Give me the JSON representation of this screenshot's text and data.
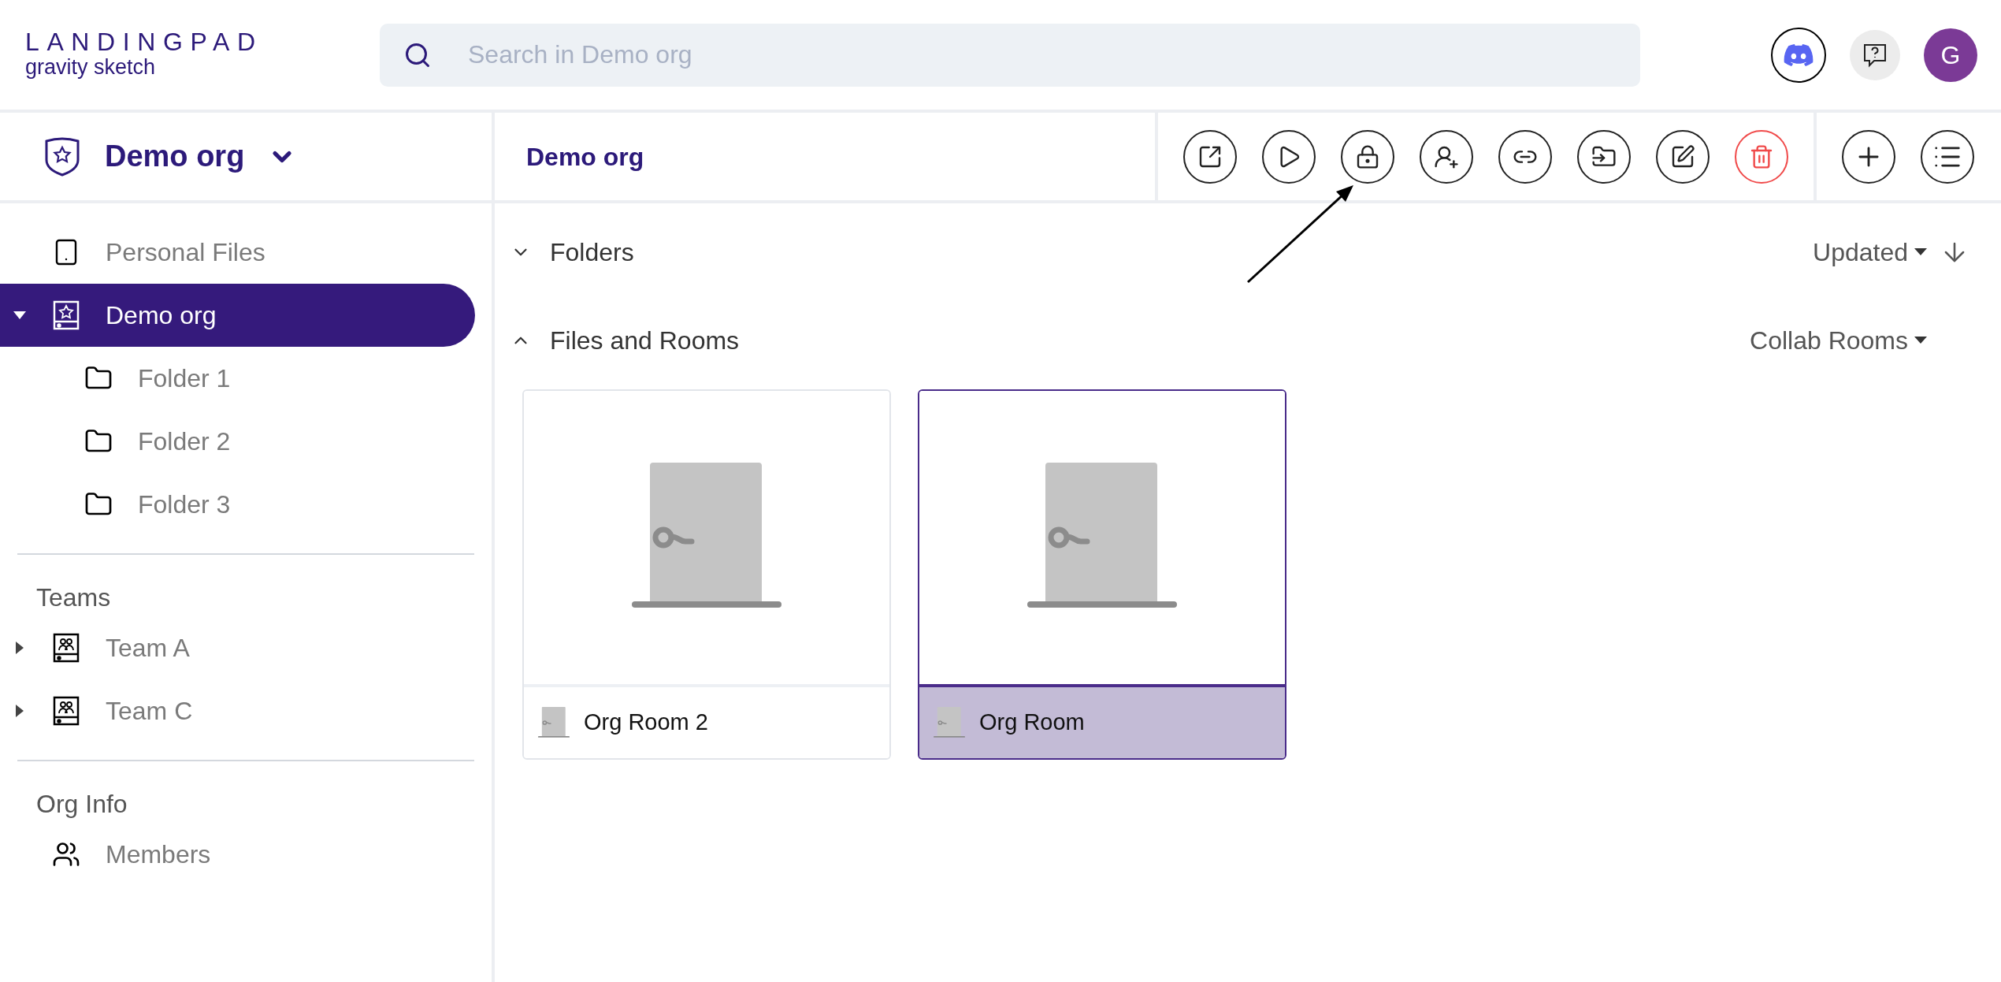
{
  "header": {
    "logo_title": "LANDINGPAD",
    "logo_subtitle": "gravity sketch",
    "search": {
      "placeholder": "Search in Demo org"
    },
    "avatar": "G"
  },
  "sidebar": {
    "org_switcher": "Demo org",
    "items": [
      {
        "label": "Personal Files",
        "kind": "personal",
        "selected": false
      },
      {
        "label": "Demo org",
        "kind": "org",
        "selected": true,
        "expanded": true,
        "children": [
          {
            "label": "Folder 1",
            "kind": "folder",
            "selected": false
          },
          {
            "label": "Folder 2",
            "kind": "folder",
            "selected": false
          },
          {
            "label": "Folder 3",
            "kind": "folder",
            "selected": false
          }
        ]
      }
    ],
    "sections": [
      {
        "title": "Teams",
        "items": [
          {
            "label": "Team A",
            "kind": "team",
            "selected": false,
            "expanded": false
          },
          {
            "label": "Team C",
            "kind": "team",
            "selected": false,
            "expanded": false
          }
        ]
      },
      {
        "title": "Org Info",
        "items": [
          {
            "label": "Members",
            "kind": "members",
            "selected": false
          }
        ]
      }
    ]
  },
  "toolbar": {
    "title": "Demo org",
    "actions": [
      {
        "kind": "open"
      },
      {
        "kind": "play"
      },
      {
        "kind": "lock"
      },
      {
        "kind": "adduser"
      },
      {
        "kind": "link"
      },
      {
        "kind": "move"
      },
      {
        "kind": "rename"
      },
      {
        "kind": "delete"
      }
    ],
    "create_actions": [
      {
        "kind": "add"
      },
      {
        "kind": "list"
      }
    ]
  },
  "sections": [
    {
      "title": "Folders",
      "expanded": false,
      "control": "Updated",
      "sort_descending": true
    },
    {
      "title": "Files and Rooms",
      "expanded": true,
      "control": "Collab Rooms"
    }
  ],
  "cards": [
    {
      "name": "Org Room 2",
      "selected": false
    },
    {
      "name": "Org Room",
      "selected": true
    }
  ]
}
